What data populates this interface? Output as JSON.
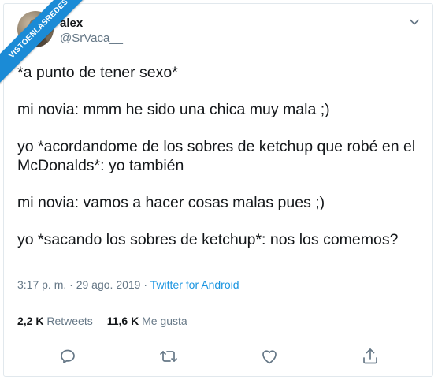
{
  "watermark": "VISTOENLASREDES",
  "user": {
    "name": "alex",
    "handle": "@SrVaca__"
  },
  "tweet": {
    "paragraphs": [
      "*a punto de tener sexo*",
      "mi novia: mmm he sido una chica muy mala ;)",
      "yo *acordandome de los sobres de ketchup que robé en el McDonalds*: yo también",
      "mi novia: vamos a hacer cosas malas pues ;)",
      "yo *sacando los sobres de ketchup*: nos los comemos?"
    ],
    "time": "3:17 p. m.",
    "separator1": " · ",
    "date": "29 ago. 2019",
    "separator2": " · ",
    "source": "Twitter for Android"
  },
  "stats": {
    "retweets_count": "2,2 K",
    "retweets_label": "Retweets",
    "likes_count": "11,6 K",
    "likes_label": "Me gusta"
  },
  "icons": {
    "caret": "chevron-down-icon",
    "reply": "reply-icon",
    "retweet": "retweet-icon",
    "like": "heart-icon",
    "share": "share-icon"
  },
  "colors": {
    "text": "#14171a",
    "muted": "#657786",
    "link": "#1b95e0",
    "ribbon": "#1b8bd6"
  }
}
